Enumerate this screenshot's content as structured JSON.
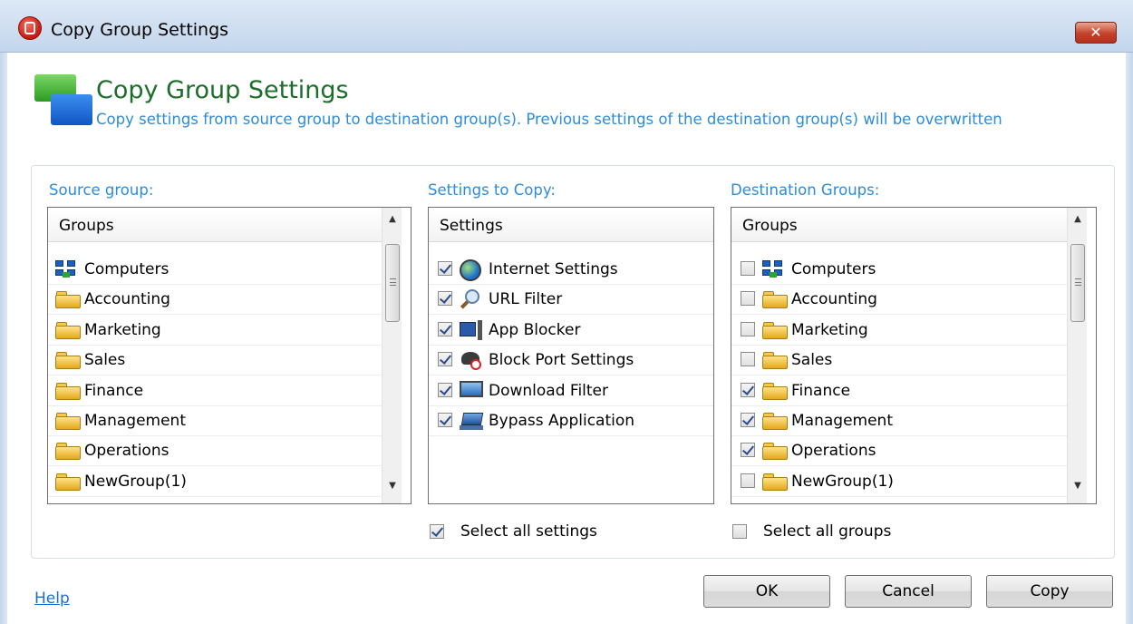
{
  "window": {
    "title": "Copy Group Settings",
    "close_glyph": "✕"
  },
  "header": {
    "title": "Copy Group Settings",
    "description": "Copy settings from source group to destination group(s). Previous settings of the destination group(s) will be overwritten"
  },
  "source": {
    "label": "Source group:",
    "column_header": "Groups",
    "items": [
      {
        "label": "Computers",
        "icon": "network-icon"
      },
      {
        "label": "Accounting",
        "icon": "folder-icon"
      },
      {
        "label": "Marketing",
        "icon": "folder-icon"
      },
      {
        "label": "Sales",
        "icon": "folder-icon"
      },
      {
        "label": "Finance",
        "icon": "folder-icon"
      },
      {
        "label": "Management",
        "icon": "folder-icon"
      },
      {
        "label": "Operations",
        "icon": "folder-icon"
      },
      {
        "label": "NewGroup(1)",
        "icon": "folder-icon"
      }
    ]
  },
  "settings": {
    "label": "Settings to Copy:",
    "column_header": "Settings",
    "items": [
      {
        "label": "Internet Settings",
        "icon": "globe-icon",
        "checked": true
      },
      {
        "label": "URL Filter",
        "icon": "magnifier-icon",
        "checked": true
      },
      {
        "label": "App Blocker",
        "icon": "app-blocker-icon",
        "checked": true
      },
      {
        "label": "Block Port Settings",
        "icon": "block-port-icon",
        "checked": true
      },
      {
        "label": "Download Filter",
        "icon": "download-filter-icon",
        "checked": true
      },
      {
        "label": "Bypass Application",
        "icon": "bypass-application-icon",
        "checked": true
      }
    ],
    "select_all_label": "Select all settings",
    "select_all_checked": true
  },
  "destination": {
    "label": "Destination Groups:",
    "column_header": "Groups",
    "items": [
      {
        "label": "Computers",
        "icon": "network-icon",
        "checked": false
      },
      {
        "label": "Accounting",
        "icon": "folder-icon",
        "checked": false
      },
      {
        "label": "Marketing",
        "icon": "folder-icon",
        "checked": false
      },
      {
        "label": "Sales",
        "icon": "folder-icon",
        "checked": false
      },
      {
        "label": "Finance",
        "icon": "folder-icon",
        "checked": true
      },
      {
        "label": "Management",
        "icon": "folder-icon",
        "checked": true
      },
      {
        "label": "Operations",
        "icon": "folder-icon",
        "checked": true
      },
      {
        "label": "NewGroup(1)",
        "icon": "folder-icon",
        "checked": false
      }
    ],
    "select_all_label": "Select all groups",
    "select_all_checked": false
  },
  "footer": {
    "help": "Help",
    "ok": "OK",
    "cancel": "Cancel",
    "copy": "Copy"
  },
  "scroll": {
    "up": "▲",
    "down": "▼"
  },
  "colors": {
    "accent_blue": "#2d8bd8",
    "title_green": "#1c6e2a",
    "close_red": "#c4412b"
  }
}
